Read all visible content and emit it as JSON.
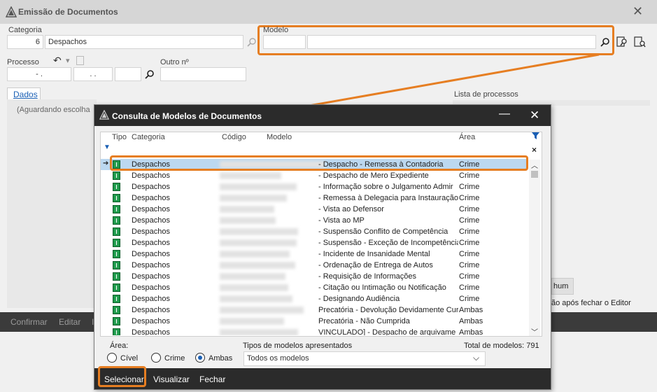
{
  "window": {
    "title": "Emissão de Documentos"
  },
  "form": {
    "categoria_label": "Categoria",
    "categoria_code": "6",
    "categoria_name": "Despachos",
    "modelo_label": "Modelo",
    "processo_label": "Processo",
    "processo_v1": "- .",
    "processo_v2": ". .",
    "outro_label": "Outro nº",
    "tab_dados": "Dados",
    "aguardando": "(Aguardando escolha",
    "lista_label": "Lista de processos",
    "nenhum_partial": "hum",
    "editor_partial": "ão após fechar o Editor"
  },
  "outer_toolbar": {
    "confirmar": "Confirmar",
    "editar": "Editar",
    "frag": "I"
  },
  "dialog": {
    "title": "Consulta de Modelos de Documentos",
    "columns": {
      "tipo": "Tipo",
      "categoria": "Categoria",
      "codigo": "Código",
      "modelo": "Modelo",
      "area": "Área"
    },
    "rows": [
      {
        "categoria": "Despachos",
        "modelo": "- Despacho - Remessa à Contadoria",
        "area": "Crime"
      },
      {
        "categoria": "Despachos",
        "modelo": "- Despacho de Mero Expediente",
        "area": "Crime"
      },
      {
        "categoria": "Despachos",
        "modelo": "- Informação sobre o Julgamento Admir",
        "area": "Crime"
      },
      {
        "categoria": "Despachos",
        "modelo": "- Remessa à Delegacia para Instauração",
        "area": "Crime"
      },
      {
        "categoria": "Despachos",
        "modelo": "- Vista ao Defensor",
        "area": "Crime"
      },
      {
        "categoria": "Despachos",
        "modelo": "- Vista ao MP",
        "area": "Crime"
      },
      {
        "categoria": "Despachos",
        "modelo": "- Suspensão Conflito de Competência",
        "area": "Crime"
      },
      {
        "categoria": "Despachos",
        "modelo": "- Suspensão - Exceção de Incompetência",
        "area": "Crime"
      },
      {
        "categoria": "Despachos",
        "modelo": "- Incidente de Insanidade Mental",
        "area": "Crime"
      },
      {
        "categoria": "Despachos",
        "modelo": "- Ordenação de Entrega de Autos",
        "area": "Crime"
      },
      {
        "categoria": "Despachos",
        "modelo": "- Requisição de Informações",
        "area": "Crime"
      },
      {
        "categoria": "Despachos",
        "modelo": "- Citação ou Intimação ou Notificação",
        "area": "Crime"
      },
      {
        "categoria": "Despachos",
        "modelo": "- Designando Audiência",
        "area": "Crime"
      },
      {
        "categoria": "Despachos",
        "modelo": "Precatória - Devolução Devidamente Cur",
        "area": "Ambas"
      },
      {
        "categoria": "Despachos",
        "modelo": "Precatória - Não Cumprida",
        "area": "Ambas"
      },
      {
        "categoria": "Despachos",
        "modelo": "VINCULADO] - Despacho de arquivame",
        "area": "Ambas"
      }
    ],
    "area_label": "Área:",
    "radio_civel": "Cível",
    "radio_crime": "Crime",
    "radio_ambas": "Ambas",
    "tipos_label": "Tipos de modelos apresentados",
    "tipos_value": "Todos os modelos",
    "total_label": "Total de modelos: 791",
    "btn_selecionar": "Selecionar",
    "btn_visualizar": "Visualizar",
    "btn_fechar": "Fechar"
  },
  "colors": {
    "accent_orange": "#e67e22",
    "dark_bar": "#2b2b2b",
    "selection": "#bcd8f0",
    "type_icon": "#1e9a4b"
  }
}
